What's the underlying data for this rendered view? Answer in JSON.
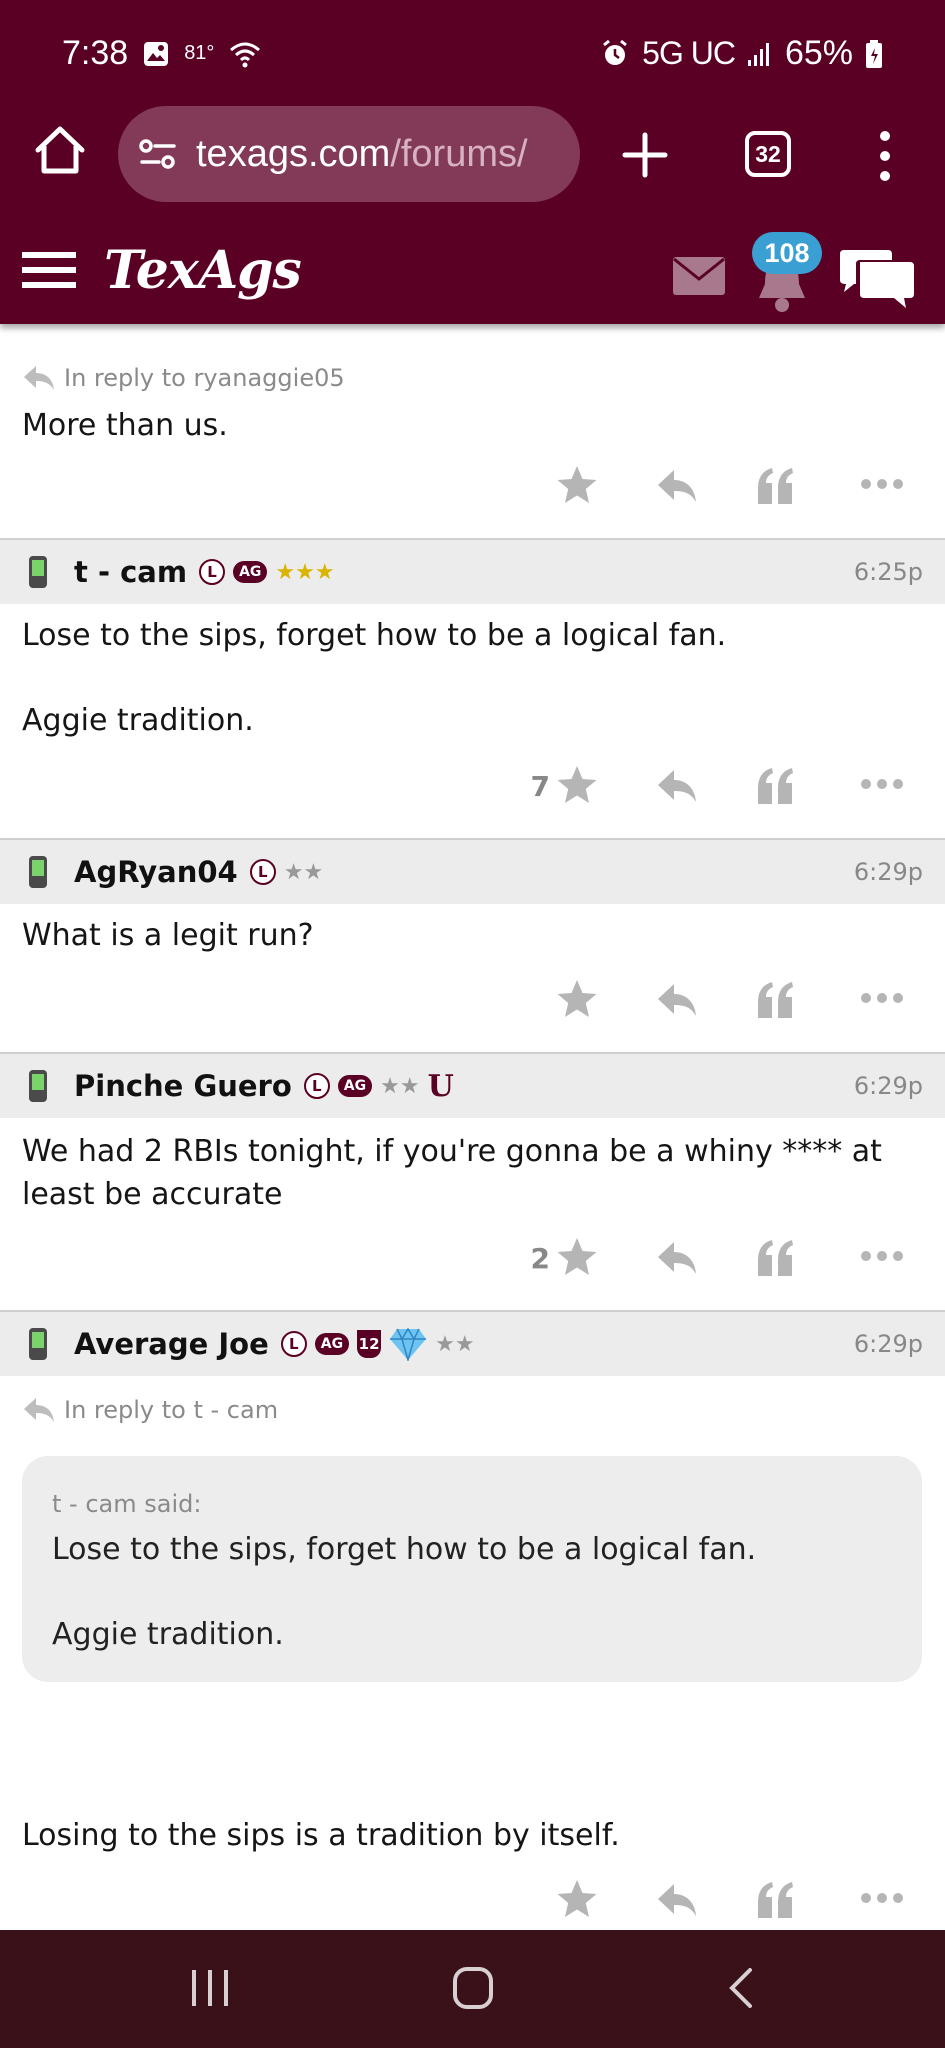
{
  "status_bar": {
    "time": "7:38",
    "temperature": "81°",
    "network": "5G UC",
    "battery": "65%"
  },
  "browser": {
    "url_domain": "texags.com",
    "url_path": "/forums/",
    "tab_count": "32"
  },
  "site": {
    "logo": "TexAgs",
    "notification_count": "108"
  },
  "posts": [
    {
      "reply_to": "In reply to ryanaggie05",
      "body": "More than us."
    },
    {
      "username": "t - cam",
      "time": "6:25p",
      "badge_l": "L",
      "badge_ag": "AG",
      "stars": "★★★",
      "body_line1": "Lose to the sips, forget how to be a logical fan.",
      "body_line2": "Aggie tradition.",
      "star_count": "7"
    },
    {
      "username": "AgRyan04",
      "time": "6:29p",
      "badge_l": "L",
      "stars": "★★",
      "body": "What is a legit run?"
    },
    {
      "username": "Pinche Guero",
      "time": "6:29p",
      "badge_l": "L",
      "badge_ag": "AG",
      "stars": "★★",
      "badge_u": "U",
      "body": "We had 2 RBIs tonight, if you're gonna be a whiny **** at least be accurate",
      "star_count": "2"
    },
    {
      "username": "Average Joe",
      "time": "6:29p",
      "badge_l": "L",
      "badge_ag": "AG",
      "badge_12": "12",
      "stars": "★★",
      "reply_to": "In reply to t - cam",
      "quote_author": "t - cam said:",
      "quote_line1": "Lose to the sips, forget how to be a logical fan.",
      "quote_line2": "Aggie tradition.",
      "body": "Losing to the sips is a tradition by itself."
    }
  ],
  "colors": {
    "maroon": "#5a0025",
    "url_pill": "#823a58",
    "badge_blue": "#3a9fd3",
    "icon_gray": "#b5b5b5",
    "nav_bar": "#3a1119"
  },
  "icons": [
    "home-icon",
    "site-settings-icon",
    "plus-icon",
    "tabs-icon",
    "more-vert-icon",
    "hamburger-icon",
    "mail-icon",
    "bell-icon",
    "chat-icon",
    "phone-icon",
    "star-icon",
    "reply-icon",
    "quote-icon",
    "more-icon",
    "recent-apps-icon",
    "nav-home-icon",
    "back-icon"
  ]
}
